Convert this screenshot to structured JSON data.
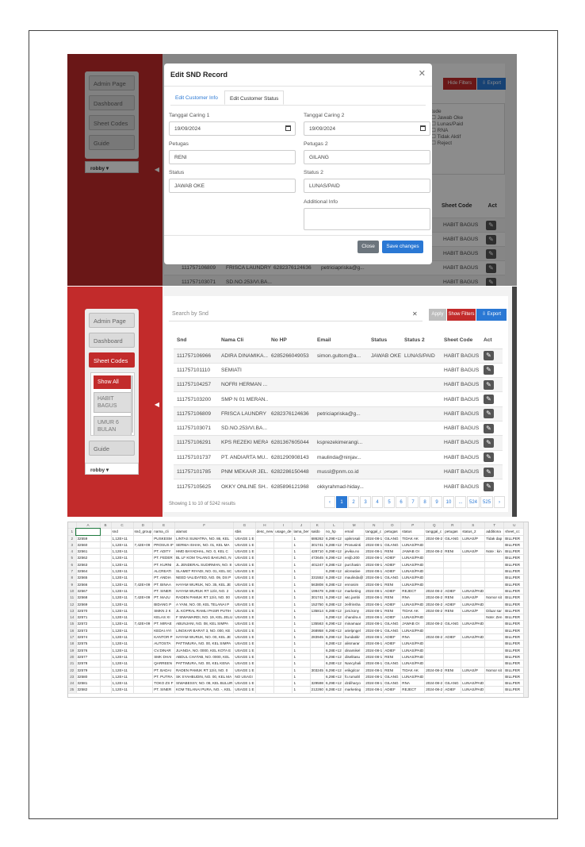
{
  "sidebar": {
    "admin_page": "Admin Page",
    "dashboard": "Dashboard",
    "sheet_codes": "Sheet Codes",
    "guide": "Guide",
    "sub_items": [
      "Show All",
      "HABIT BAGUS",
      "UMUR 6 BULAN"
    ],
    "user": "robby",
    "toggle_icon": "caret-left-icon"
  },
  "modal": {
    "title": "Edit SND Record",
    "tabs": [
      "Edit Customer Info",
      "Edit Customer Status"
    ],
    "labels": {
      "tanggal_caring_1": "Tanggal Caring 1",
      "tanggal_caring_2": "Tanggal Caring 2",
      "petugas": "Petugas",
      "petugas_2": "Petugas 2",
      "status": "Status",
      "status_2": "Status 2",
      "additional_info": "Additional Info"
    },
    "values": {
      "tanggal_caring_1": "19/09/2024",
      "tanggal_caring_2": "19/09/2024",
      "petugas": "RENI",
      "petugas_2": "GILANG",
      "status": "JAWAB OKE",
      "status_2": "LUNAS/PAID"
    },
    "close_button": "Close",
    "save_button": "Save changes"
  },
  "bg_panel": {
    "hide_filters_partial": "Hide Filters",
    "export_partial": "Export",
    "filter_title": "tude",
    "filters": [
      "Jawab Oke",
      "Lunas/Paid",
      "RNA",
      "Tidak Aktif",
      "Reject"
    ],
    "sheet_code_header": "Sheet Code",
    "act_header": "Act",
    "visible_rows": [
      {
        "snd": "",
        "nama": "",
        "hp": "",
        "email": "",
        "sheet": "HABIT BAGUS"
      },
      {
        "snd": "",
        "nama": "",
        "hp": "",
        "email": "",
        "sheet": "HABIT BAGUS"
      },
      {
        "snd": "",
        "nama": "",
        "hp": "",
        "email": "",
        "sheet": "HABIT BAGUS"
      },
      {
        "snd": "111757106809",
        "nama": "FRISCA LAUNDRY",
        "hp": "6282376124636",
        "email": "petriciapriska@g...",
        "sheet": "HABIT BAGUS"
      },
      {
        "snd": "111757103071",
        "nama": "SD.NO.253/VI.BA...",
        "hp": "",
        "email": "",
        "sheet": "HABIT BAGUS"
      }
    ]
  },
  "main_table": {
    "search_placeholder": "Search by Snd",
    "apply": "Apply",
    "show_filters": "Show Filters",
    "export": "Export",
    "headers": [
      "Snd",
      "Nama Cli",
      "No HP",
      "Email",
      "Status",
      "Status 2",
      "Sheet Code",
      "Act"
    ],
    "rows": [
      [
        "111757106966",
        "ADIRA DINAMIKA...",
        "6285266049053",
        "simon.gultom@a...",
        "JAWAB OKE",
        "LUNAS/PAID",
        "HABIT BAGUS"
      ],
      [
        "111757101110",
        "SEMIATI",
        "",
        "",
        "",
        "",
        "HABIT BAGUS"
      ],
      [
        "111757104257",
        "NOFRI HERMAN ...",
        "",
        "",
        "",
        "",
        "HABIT BAGUS"
      ],
      [
        "111757103200",
        "SMP N 01 MERAN...",
        "",
        "",
        "",
        "",
        "HABIT BAGUS"
      ],
      [
        "111757106809",
        "FRISCA LAUNDRY",
        "6282376124636",
        "petriciapriska@g...",
        "",
        "",
        "HABIT BAGUS"
      ],
      [
        "111757103071",
        "SD.NO.253/VI.BA...",
        "",
        "",
        "",
        "",
        "HABIT BAGUS"
      ],
      [
        "111757106291",
        "KPS REZEKI MERA...",
        "6281367605044",
        "ksprezekimerangi...",
        "",
        "",
        "HABIT BAGUS"
      ],
      [
        "111757101737",
        "PT. ANDIARTA MU...",
        "6281290908143",
        "maulinda@ninjav...",
        "",
        "",
        "HABIT BAGUS"
      ],
      [
        "111757101785",
        "PNM MEKAAR JEL...",
        "6282286150448",
        "mussl@pnm.co.id",
        "",
        "",
        "HABIT BAGUS"
      ],
      [
        "111757105625",
        "OKKY ONLINE SH...",
        "6285896121968",
        "okkyrahmad-hiday...",
        "",
        "",
        "HABIT BAGUS"
      ]
    ],
    "footer": "Showing 1 to 10 of 5242 results",
    "pagination": [
      "‹",
      "1",
      "2",
      "3",
      "4",
      "5",
      "6",
      "7",
      "8",
      "9",
      "10",
      "...",
      "524",
      "525",
      "›"
    ]
  },
  "spreadsheet": {
    "columns": [
      "",
      "A",
      "B",
      "C",
      "D",
      "E",
      "F",
      "G",
      "H",
      "I",
      "J",
      "K",
      "L",
      "M",
      "N",
      "O",
      "P",
      "Q",
      "R",
      "S",
      "T",
      "U"
    ],
    "rows": [
      [
        "1",
        "",
        "",
        "snd",
        "snd_group",
        "nama_cli",
        "alamat",
        "sbis",
        "desc_new",
        "usage_de",
        "lama_ber",
        "saldo",
        "no_hp",
        "email",
        "tanggal_c",
        "petugas",
        "status",
        "tanggal_c",
        "petugas",
        "status_2",
        "additiona",
        "sheet_cc"
      ],
      [
        "2",
        "32559",
        "",
        "1,12E+11",
        "",
        "PUSKESM",
        "LINTAS SUMATRA, NO. 86, KEL",
        "USAGE 1 E",
        "",
        "",
        "1",
        "686262",
        "6,29E+12",
        "upikrosali",
        "2024-08-1",
        "GILANG",
        "TIDAK AK",
        "2024-08-2",
        "GILANG",
        "LUNAS/P",
        "Tidak dap",
        "BILLPER"
      ],
      [
        "3",
        "32560",
        "",
        "1,12E+11",
        "7,42E+09",
        "PROSUS IF",
        "SERMA ISHAK, NO. 01, KEL MA",
        "USAGE 1 E",
        "",
        "",
        "1",
        "301741",
        "6,28E+12",
        "Prosusinti",
        "2024-08-1",
        "GILANG",
        "LUNAS/PAID",
        "",
        "",
        "",
        "",
        "BILLPER"
      ],
      [
        "4",
        "32561",
        "",
        "1,12E+11",
        "",
        "PT. ADITY",
        "HMD BAYADHAL, NO. 0, KEL C",
        "USAGE 1 E",
        "",
        "",
        "1",
        "428710",
        "6,29E+12",
        "jevika.no",
        "2024-08-1",
        "RENI",
        "JAWAB OI",
        "2024-08-2",
        "RENI",
        "LUNAS/P",
        "Note : kin",
        "BILLPER"
      ],
      [
        "5",
        "32562",
        "",
        "1,12E+11",
        "",
        "PT. FEDER",
        "BL LF KOM TALANG BAKUNG, N",
        "USAGE 1 E",
        "",
        "",
        "1",
        "472645",
        "6,29E+12",
        "enijb.200",
        "2024-08-1",
        "ADIEF",
        "LUNAS/PAID",
        "",
        "",
        "",
        "",
        "BILLPER"
      ],
      [
        "6",
        "32563",
        "",
        "1,12E+11",
        "",
        "PT. KURNI",
        "JL JENDERAL SUDIRMAN, NO. 8",
        "USAGE 1 E",
        "",
        "",
        "1",
        "401247",
        "6,28E+12",
        "purchasin",
        "2024-08-1",
        "ADIEF",
        "LUNAS/PAID",
        "",
        "",
        "",
        "",
        "BILLPER"
      ],
      [
        "7",
        "32564",
        "",
        "1,12E+11",
        "",
        "ALCREATI",
        "SLAMET RIYADI, NO. 01, KEL SC",
        "USAGE 1 E",
        "",
        "",
        "1",
        "",
        "6,29E+12",
        "alcreative",
        "2024-08-1",
        "ADIEF",
        "LUNAS/PAID",
        "",
        "",
        "",
        "",
        "BILLPER"
      ],
      [
        "8",
        "32565",
        "",
        "1,12E+11",
        "",
        "PT. ANDIA",
        "NEED VALIDATED, NO. 09, DS P",
        "USAGE 1 E",
        "",
        "",
        "1",
        "331552",
        "6,28E+12",
        "maulinda@",
        "2024-08-1",
        "GILANG",
        "LUNAS/PAID",
        "",
        "",
        "",
        "",
        "BILLPER"
      ],
      [
        "9",
        "32566",
        "",
        "1,12E+11",
        "7,42E+09",
        "PT. BINAA",
        "HAYAM WURUK, NO. 35, KEL JE",
        "USAGE 1 E",
        "",
        "",
        "1",
        "563808",
        "6,28E+12",
        "ennosim",
        "2024-08-1",
        "RENI",
        "LUNAS/PAID",
        "",
        "",
        "",
        "",
        "BILLPER"
      ],
      [
        "10",
        "32567",
        "",
        "1,12E+11",
        "",
        "PT. SINER",
        "HAYAM WURUK RT 12/4, NO. 2",
        "USAGE 1 E",
        "",
        "",
        "1",
        "199478",
        "6,28E+12",
        "marketing",
        "2024-08-1",
        "ADIEF",
        "REJECT",
        "2024-08-2",
        "ADIEF",
        "LUNAS/PAID",
        "",
        "BILLPER"
      ],
      [
        "11",
        "32568",
        "",
        "1,12E+11",
        "7,42E+09",
        "PT. MAJU",
        "RADEN PAMUK RT 12/4, NO. 00",
        "USAGE 1 E",
        "",
        "",
        "1",
        "301741",
        "6,29E+12",
        "wtc.jambi",
        "2024-08-1",
        "RENI",
        "RNA",
        "2024-08-2",
        "RENI",
        "LUNAS/P",
        "Nomor sit",
        "BILLPER"
      ],
      [
        "12",
        "32569",
        "",
        "1,12E+11",
        "",
        "BIDANG P",
        "A YANI, NO. 00, KEL TELANAI P",
        "USAGE 1 E",
        "",
        "",
        "1",
        "152750",
        "6,28E+12",
        "zeifrinsha",
        "2024-08-1",
        "ADIEF",
        "LUNAS/PAID",
        "2024-08-2",
        "ADIEF",
        "LUNAS/PAID",
        "",
        "BILLPER"
      ],
      [
        "13",
        "32570",
        "",
        "1,12E+11",
        "",
        "SMKN 2 K",
        "JL KOPRAL RAMLI PASIR PUTIH",
        "USAGE 1 E",
        "",
        "",
        "1",
        "135814",
        "6,28E+12",
        "joni.kony",
        "2024-08-1",
        "RENI",
        "TIDAK AK",
        "2024-08-2",
        "RENI",
        "LUNAS/P",
        "Diluar sar",
        "BILLPER"
      ],
      [
        "14",
        "32571",
        "",
        "1,12E+11",
        "",
        "KELAS XI",
        "F SIWAWARDI, NO. 19, KEL JELU",
        "USAGE 1 E",
        "",
        "",
        "1",
        "",
        "6,29E+12",
        "chandra.s",
        "2024-08-1",
        "ADIEF",
        "LUNAS/PAID",
        "",
        "",
        "",
        "Note: Zen",
        "BILLPER"
      ],
      [
        "15",
        "32572",
        "",
        "1,12E+11",
        "7,42E+09",
        "PT. MIRAE",
        "ABUNJANI, NO. 08, KEL SIMPA",
        "USAGE 1 E",
        "",
        "",
        "1",
        "135563",
        "6,29E+12",
        "minamaar",
        "2024-08-1",
        "GILANG",
        "JAWAB OI",
        "2024-08-2",
        "GILANG",
        "LUNAS/PAID",
        "",
        "BILLPER"
      ],
      [
        "16",
        "32573",
        "",
        "1,12E+11",
        "",
        "KEDAI AYI",
        "LINGKAR BARAT 3, NO. 000, KE",
        "USAGE 1 E",
        "",
        "",
        "1",
        "268958",
        "6,29E+12",
        "arielpngel",
        "2024-08-1",
        "GILANG",
        "LUNAS/PAID",
        "",
        "",
        "",
        "",
        "BILLPER"
      ],
      [
        "17",
        "32574",
        "",
        "1,12E+11",
        "",
        "KANTOR P",
        "HAYAM WURUK, NO. 00, KEL JE",
        "USAGE 1 E",
        "",
        "",
        "1",
        "283945",
        "6,29E+12",
        "bundatitir",
        "2024-08-1",
        "ADIEF",
        "RNA",
        "2024-08-2",
        "ADIEF",
        "LUNAS/PAID",
        "",
        "BILLPER"
      ],
      [
        "18",
        "32575",
        "",
        "1,12E+11",
        "",
        "AUTOSTA",
        "PATTIMURA, NO. 00, KEL SIMPA",
        "USAGE 1 E",
        "",
        "",
        "1",
        "",
        "6,28E+12",
        "alismarar",
        "2024-08-1",
        "ADIEF",
        "LUNAS/PAID",
        "",
        "",
        "",
        "",
        "BILLPER"
      ],
      [
        "19",
        "32576",
        "",
        "1,12E+11",
        "",
        "CV.DINAR",
        "JUANDA, NO. 0000, KEL KOTA E",
        "USAGE 1 E",
        "",
        "",
        "1",
        "",
        "6,28E+12",
        "dinamikel",
        "2024-08-1",
        "ADIEF",
        "LUNAS/PAID",
        "",
        "",
        "",
        "",
        "BILLPER"
      ],
      [
        "20",
        "32577",
        "",
        "1,12E+11",
        "",
        "SMK DHAI",
        "ABDUL CHATAB, NO. 0000, KEL",
        "USAGE 1 E",
        "",
        "",
        "1",
        "",
        "6,29E+12",
        "diselitasu",
        "2024-08-1",
        "RENI",
        "LUNAS/PAID",
        "",
        "",
        "",
        "",
        "BILLPER"
      ],
      [
        "21",
        "32578",
        "",
        "1,12E+11",
        "",
        "QARREEN",
        "PATTIMURA, NO. 00, KEL KENA",
        "USAGE 1 E",
        "",
        "",
        "1",
        "",
        "6,28E+12",
        "Nancyhali",
        "2024-08-1",
        "GILANG",
        "LUNAS/PAID",
        "",
        "",
        "",
        "",
        "BILLPER"
      ],
      [
        "22",
        "32579",
        "",
        "1,12E+11",
        "",
        "PT. BADAI",
        "RADEN PAMUK RT 12/4, NO. 0",
        "USAGE 1 E",
        "",
        "",
        "1",
        "303245",
        "6,29E+12",
        "erikgdcor",
        "2024-08-1",
        "RENI",
        "TIDAK AK",
        "2024-08-2",
        "RENI",
        "LUNAS/P",
        "Nomor sit",
        "BILLPER"
      ],
      [
        "23",
        "32580",
        "",
        "1,12E+11",
        "",
        "PT. PUTRA",
        "SK SYAHBUDIN, NO. 00, KEL MA",
        "NO USAGI",
        "",
        "",
        "1",
        "",
        "6,29E+12",
        "fo.rumahl",
        "2024-08-1",
        "GILANG",
        "LUNAS/PAID",
        "",
        "",
        "",
        "",
        "BILLPER"
      ],
      [
        "24",
        "32581",
        "",
        "1,12E+11",
        "",
        "TOKO ZS F",
        "SIWABESSY, NO. 08, KEL BULUR",
        "USAGE 1 E",
        "",
        "",
        "1",
        "329598",
        "6,29E+12",
        "dzdiharyo",
        "2024-08-1",
        "GILANG",
        "RNA",
        "2024-08-2",
        "GILANG",
        "LUNAS/PAID",
        "",
        "BILLPER"
      ],
      [
        "25",
        "32582",
        "",
        "1,12E+11",
        "",
        "PT. SINER",
        "KOM TELANAI PURA, NO. -, KEL",
        "USAGE 1 E",
        "",
        "",
        "1",
        "212260",
        "6,28E+12",
        "marketing",
        "2024-08-1",
        "ADIEF",
        "REJECT",
        "2024-08-2",
        "ADIEF",
        "LUNAS/PAID",
        "",
        "BILLPER"
      ]
    ]
  },
  "colors": {
    "brand_red": "#c22b2b",
    "primary_blue": "#2a78d4",
    "close_gray": "#6c757d"
  }
}
